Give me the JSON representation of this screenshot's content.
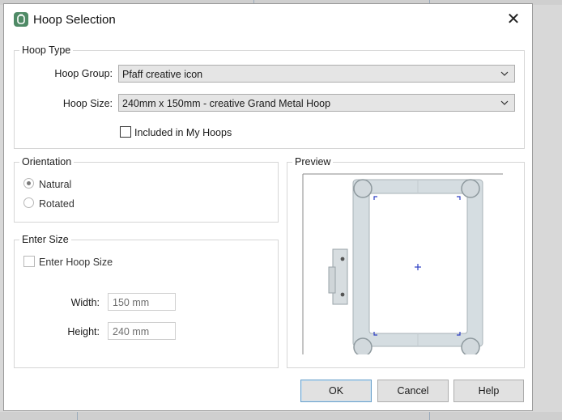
{
  "window": {
    "title": "Hoop Selection",
    "close_glyph": "✕",
    "icon": "hoop-app-icon"
  },
  "hoop_type": {
    "legend": "Hoop Type",
    "group_label": "Hoop Group:",
    "group_value": "Pfaff creative icon",
    "size_label": "Hoop Size:",
    "size_value": "240mm x 150mm - creative Grand Metal Hoop",
    "included_label": "Included in My Hoops",
    "included_checked": false
  },
  "orientation": {
    "legend": "Orientation",
    "options": [
      {
        "label": "Natural",
        "selected": true
      },
      {
        "label": "Rotated",
        "selected": false
      }
    ]
  },
  "enter_size": {
    "legend": "Enter Size",
    "checkbox_label": "Enter Hoop Size",
    "checked": false,
    "width_label": "Width:",
    "width_value": "150 mm",
    "height_label": "Height:",
    "height_value": "240 mm"
  },
  "preview": {
    "legend": "Preview"
  },
  "buttons": {
    "ok": "OK",
    "cancel": "Cancel",
    "help": "Help"
  },
  "colors": {
    "accent": "#6aa0c9",
    "frame": "#d3dbe0",
    "center_mark": "#2d3fc4"
  }
}
